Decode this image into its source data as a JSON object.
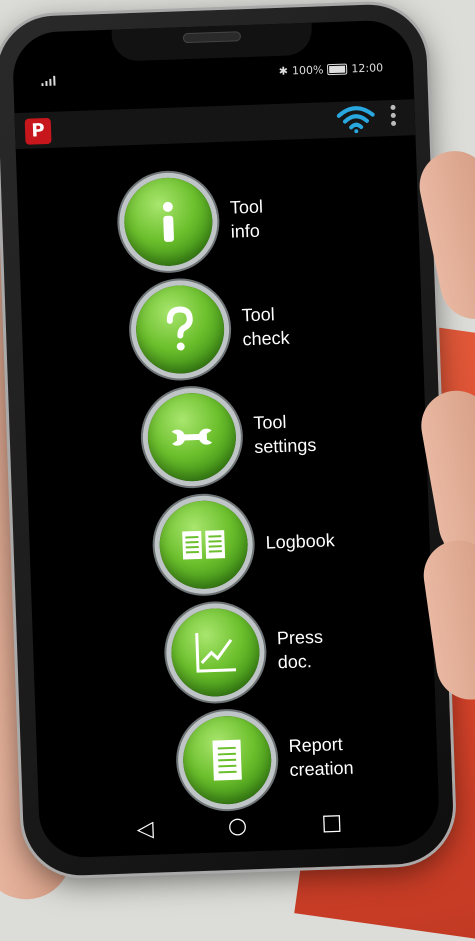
{
  "status_bar": {
    "battery_percent": "100%",
    "time": "12:00",
    "icons": [
      "signal-icon",
      "bluetooth-icon",
      "battery-icon"
    ]
  },
  "app_bar": {
    "logo_text": "P",
    "icons": [
      "wifi-icon",
      "overflow-menu-icon"
    ],
    "accent": "#29a8e0"
  },
  "menu": {
    "items": [
      {
        "label": "Tool\ninfo",
        "icon": "info-icon"
      },
      {
        "label": "Tool\ncheck",
        "icon": "question-icon"
      },
      {
        "label": "Tool\nsettings",
        "icon": "wrench-icon"
      },
      {
        "label": "Logbook",
        "icon": "book-icon"
      },
      {
        "label": "Press\ndoc.",
        "icon": "chart-icon"
      },
      {
        "label": "Report\ncreation",
        "icon": "document-icon"
      }
    ],
    "button_color": "#6bbf2c"
  },
  "nav_bar": {
    "back": "◁",
    "home": "○",
    "recents": "□"
  }
}
